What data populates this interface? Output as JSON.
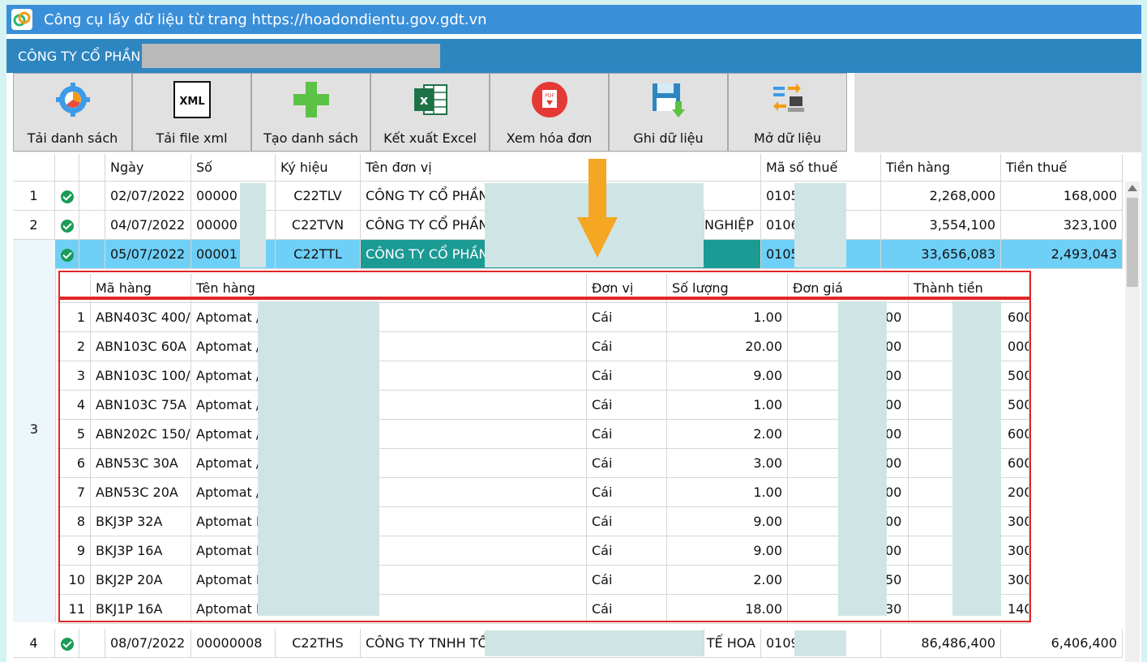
{
  "window": {
    "title": "Công cụ lấy dữ liệu từ trang https://hoadondientu.gov.gdt.vn"
  },
  "company": {
    "name_prefix": "CÔNG TY CỔ PHẦN"
  },
  "toolbar": [
    {
      "name": "load-list-button",
      "icon": "gear-chart-icon",
      "label": "Tải danh sách"
    },
    {
      "name": "load-xml-button",
      "icon": "xml-file-icon",
      "label": "Tải file xml"
    },
    {
      "name": "create-list-button",
      "icon": "plus-icon",
      "label": "Tạo danh sách"
    },
    {
      "name": "export-excel-button",
      "icon": "excel-icon",
      "label": "Kết xuất Excel"
    },
    {
      "name": "view-invoice-button",
      "icon": "pdf-icon",
      "label": "Xem hóa đơn"
    },
    {
      "name": "save-data-button",
      "icon": "floppy-download-icon",
      "label": "Ghi dữ liệu"
    },
    {
      "name": "open-data-button",
      "icon": "transfer-computer-icon",
      "label": "Mở dữ liệu"
    }
  ],
  "grid": {
    "headers": [
      "Ngày",
      "Số",
      "Ký hiệu",
      "Tên đơn vị",
      "Mã số thuế",
      "Tiền hàng",
      "Tiền thuế"
    ],
    "rows": [
      {
        "idx": "1",
        "date": "02/07/2022",
        "num": "00000",
        "symbol": "C22TLV",
        "unit": "CÔNG TY CỔ PHẦN",
        "unit_tail": "",
        "tax": "0105",
        "goods": "2,268,000",
        "vat": "168,000"
      },
      {
        "idx": "2",
        "date": "04/07/2022",
        "num": "00000",
        "symbol": "C22TVN",
        "unit": "CÔNG TY CỔ PHẦN",
        "unit_tail": "NGHIỆP",
        "tax": "0106",
        "goods": "3,554,100",
        "vat": "323,100"
      },
      {
        "idx": "3",
        "date": "05/07/2022",
        "num": "00001",
        "symbol": "C22TTL",
        "unit": "CÔNG TY CỔ PHẦN",
        "unit_tail": "",
        "tax": "0105",
        "goods": "33,656,083",
        "vat": "2,493,043"
      },
      {
        "idx": "4",
        "date": "08/07/2022",
        "num": "00000008",
        "symbol": "C22THS",
        "unit": "CÔNG TY TNHH TỔ",
        "unit_tail": "TẾ HOA",
        "tax": "0109",
        "goods": "86,486,400",
        "vat": "6,406,400"
      }
    ]
  },
  "detail": {
    "headers": [
      "Mã hàng",
      "Tên hàng",
      "Đơn vị",
      "Số lượng",
      "Đơn giá",
      "Thành tiền"
    ],
    "rows": [
      {
        "idx": "1",
        "code": "ABN403C 400/",
        "name": "Aptomat /",
        "unit": "Cái",
        "qty": "1.00",
        "price": "00",
        "total": "600"
      },
      {
        "idx": "2",
        "code": "ABN103C 60A",
        "name": "Aptomat /",
        "unit": "Cái",
        "qty": "20.00",
        "price": "00",
        "total": "000"
      },
      {
        "idx": "3",
        "code": "ABN103C 100/",
        "name": "Aptomat /",
        "unit": "Cái",
        "qty": "9.00",
        "price": "00",
        "total": "500"
      },
      {
        "idx": "4",
        "code": "ABN103C 75A",
        "name": "Aptomat /",
        "unit": "Cái",
        "qty": "1.00",
        "price": "00",
        "total": "500"
      },
      {
        "idx": "5",
        "code": "ABN202C 150/",
        "name": "Aptomat /",
        "unit": "Cái",
        "qty": "2.00",
        "price": "00",
        "total": "600"
      },
      {
        "idx": "6",
        "code": "ABN53C 30A",
        "name": "Aptomat /",
        "unit": "Cái",
        "qty": "3.00",
        "price": "00",
        "total": "600"
      },
      {
        "idx": "7",
        "code": "ABN53C 20A",
        "name": "Aptomat /",
        "unit": "Cái",
        "qty": "1.00",
        "price": "00",
        "total": "200"
      },
      {
        "idx": "8",
        "code": "BKJ3P 32A",
        "name": "Aptomat I",
        "unit": "Cái",
        "qty": "9.00",
        "price": "00",
        "total": "300"
      },
      {
        "idx": "9",
        "code": "BKJ3P 16A",
        "name": "Aptomat I",
        "unit": "Cái",
        "qty": "9.00",
        "price": "00",
        "total": "300"
      },
      {
        "idx": "10",
        "code": "BKJ2P 20A",
        "name": "Aptomat I",
        "unit": "Cái",
        "qty": "2.00",
        "price": "50",
        "total": "300"
      },
      {
        "idx": "11",
        "code": "BKJ1P 16A",
        "name": "Aptomat I",
        "unit": "Cái",
        "qty": "18.00",
        "price": "30",
        "total": "140"
      }
    ]
  },
  "colors": {
    "titlebar": "#3a8fd9",
    "company_bar": "#2e86c1",
    "selected_row": "#6fd0f7",
    "highlight": "#e12626"
  }
}
